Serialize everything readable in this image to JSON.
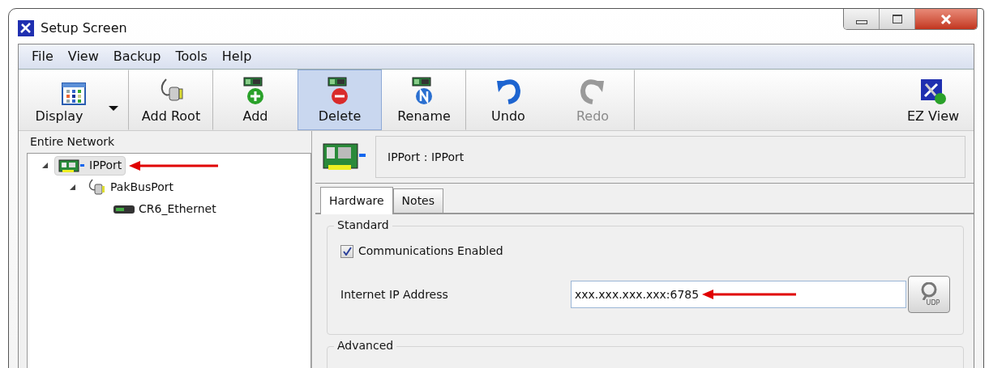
{
  "window": {
    "title": "Setup Screen"
  },
  "menu": [
    "File",
    "View",
    "Backup",
    "Tools",
    "Help"
  ],
  "toolbar": [
    {
      "kind": "display",
      "label": "Display",
      "selected": false,
      "disabled": false
    },
    {
      "kind": "addroot",
      "label": "Add Root",
      "selected": false,
      "disabled": false
    },
    {
      "kind": "add",
      "label": "Add",
      "selected": false,
      "disabled": false
    },
    {
      "kind": "delete",
      "label": "Delete",
      "selected": true,
      "disabled": false
    },
    {
      "kind": "rename",
      "label": "Rename",
      "selected": false,
      "disabled": false
    },
    {
      "kind": "undo",
      "label": "Undo",
      "selected": false,
      "disabled": false
    },
    {
      "kind": "redo",
      "label": "Redo",
      "selected": false,
      "disabled": true
    },
    {
      "kind": "ezview",
      "label": "EZ View",
      "selected": false,
      "disabled": false
    }
  ],
  "tree": {
    "heading": "Entire Network",
    "items": [
      {
        "label": "IPPort",
        "kind": "ipport",
        "selected": true,
        "expanded": true,
        "arrow": true,
        "children": [
          {
            "label": "PakBusPort",
            "kind": "pakbus",
            "selected": false,
            "expanded": true,
            "children": [
              {
                "label": "CR6_Ethernet",
                "kind": "logger",
                "selected": false
              }
            ]
          }
        ]
      }
    ]
  },
  "detail": {
    "header": "IPPort : IPPort",
    "tabs": [
      {
        "label": "Hardware",
        "selected": true
      },
      {
        "label": "Notes",
        "selected": false
      }
    ],
    "standard": {
      "title": "Standard",
      "checkbox": {
        "label": "Communications Enabled",
        "checked": true
      },
      "ip_field": {
        "label": "Internet IP Address",
        "value": "xxx.xxx.xxx.xxx:6785",
        "arrow": true
      },
      "udp_button": "UDP"
    },
    "advanced": {
      "title": "Advanced"
    }
  }
}
